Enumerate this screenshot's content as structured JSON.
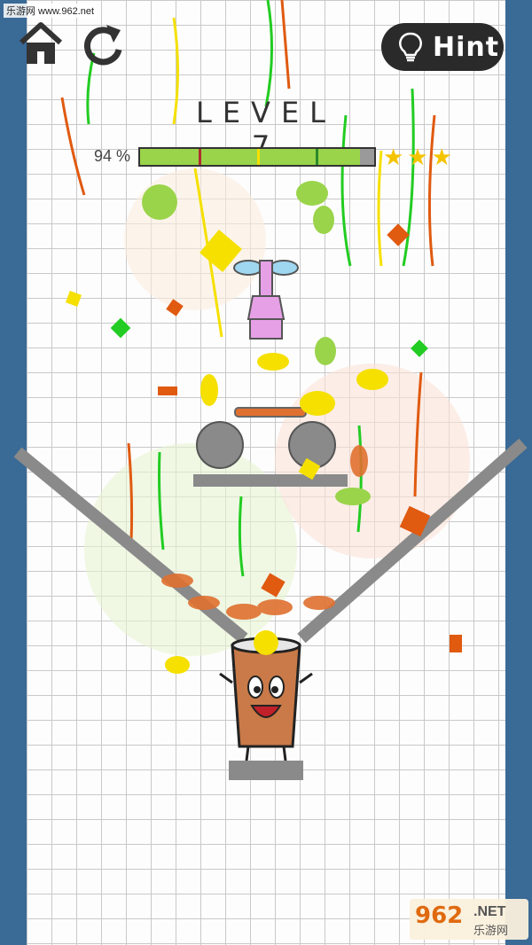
{
  "watermark_top": "乐游网 www.962.net",
  "toolbar": {
    "home_icon": "home-icon",
    "restart_icon": "restart-icon",
    "hint_label": "Hint",
    "hint_icon": "lightbulb-icon"
  },
  "level": {
    "title": "LEVEL 7"
  },
  "progress": {
    "percent_label": "94 %",
    "fraction": 0.94,
    "star_thresholds": [
      0.25,
      0.5,
      0.75
    ],
    "stars_earned": 3
  },
  "stars": [
    "★",
    "★",
    "★"
  ],
  "watermark_bottom": {
    "number": "962",
    "net": ".NET",
    "site": "乐游网"
  },
  "colors": {
    "panel_blue": "#3a6a96",
    "progress_green": "#9ad44a",
    "star_gold": "#f5c400",
    "juice_orange": "#e07030",
    "confetti_green": "#22cc22",
    "confetti_yellow": "#f5e000",
    "confetti_orange": "#e05a10",
    "cup_pink": "#e6a0e6"
  }
}
